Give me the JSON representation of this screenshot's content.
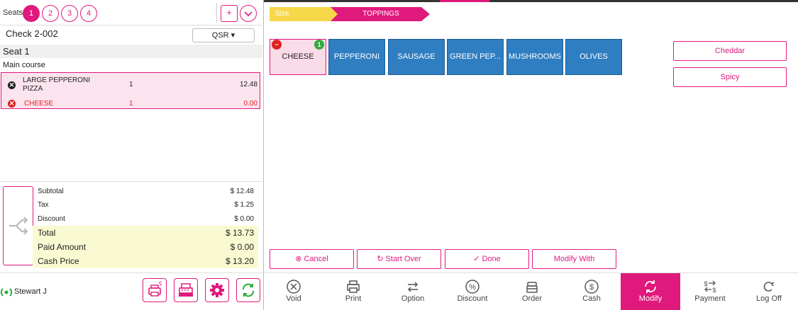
{
  "seats": {
    "label": "Seats",
    "items": [
      "1",
      "2",
      "3",
      "4"
    ],
    "add_label": "+"
  },
  "check": {
    "label": "Check 2-002",
    "type_selector": "QSR ▾"
  },
  "seat_section": {
    "title": "Seat 1",
    "course": "Main course"
  },
  "order_items": [
    {
      "name": "LARGE PEPPERONI PIZZA",
      "name_line1": "LARGE PEPPERONI",
      "name_line2": "PIZZA",
      "qty": "1",
      "price": "12.48"
    },
    {
      "name": "CHEESE",
      "qty": "1",
      "price": "0.00"
    }
  ],
  "totals": {
    "subtotal": {
      "label": "Subtotal",
      "value": "$ 12.48"
    },
    "tax": {
      "label": "Tax",
      "value": "$ 1.25"
    },
    "discount": {
      "label": "Discount",
      "value": "$ 0.00"
    },
    "total": {
      "label": "Total",
      "value": "$ 13.73"
    },
    "paid": {
      "label": "Paid Amount",
      "value": "$ 0.00"
    },
    "cash_price": {
      "label": "Cash Price",
      "value": "$ 13.20"
    }
  },
  "user": {
    "name": "Stewart J"
  },
  "breadcrumb": {
    "size": "Size",
    "toppings": "TOPPINGS"
  },
  "toppings": [
    {
      "label": "CHEESE",
      "selected": true,
      "count": "1"
    },
    {
      "label": "PEPPERONI",
      "selected": false
    },
    {
      "label": "SAUSAGE",
      "selected": false
    },
    {
      "label": "GREEN PEP...",
      "selected": false
    },
    {
      "label": "MUSHROOMS",
      "selected": false
    },
    {
      "label": "OLIVES",
      "selected": false
    }
  ],
  "modifier_options": [
    "Cheddar",
    "Spicy"
  ],
  "actions": {
    "cancel": "Cancel",
    "start_over": "Start Over",
    "done": "Done",
    "modify_with": "Modify With"
  },
  "nav": [
    {
      "label": "Void",
      "icon": "void-icon"
    },
    {
      "label": "Print",
      "icon": "print-icon"
    },
    {
      "label": "Option",
      "icon": "option-icon"
    },
    {
      "label": "Discount",
      "icon": "discount-icon"
    },
    {
      "label": "Order",
      "icon": "order-icon"
    },
    {
      "label": "Cash",
      "icon": "cash-icon"
    },
    {
      "label": "Modify",
      "icon": "modify-icon",
      "active": true
    },
    {
      "label": "Payment",
      "icon": "payment-icon"
    },
    {
      "label": "Log Off",
      "icon": "log-off-icon"
    }
  ],
  "colors": {
    "accent": "#e0197d",
    "tile_blue": "#2f7ec1",
    "crumb_yellow": "#f7d84a",
    "totals_highlight": "#fafad2",
    "item_highlight": "#fbe4ee",
    "remove_red": "#e02020",
    "badge_green": "#2eaa3c"
  }
}
